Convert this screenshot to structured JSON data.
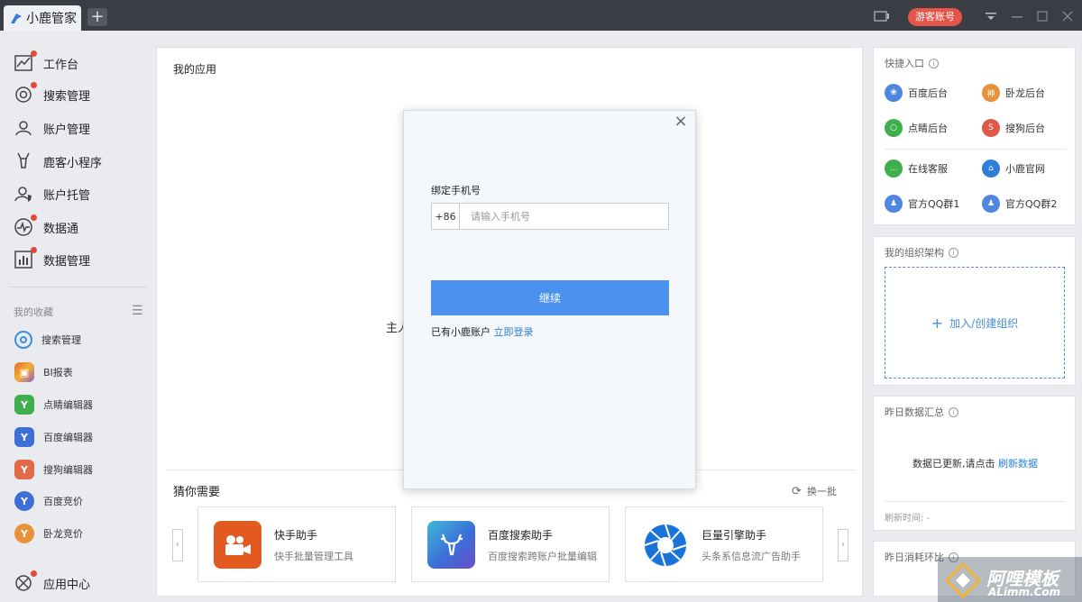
{
  "titlebar": {
    "tab_title": "小鹿管家",
    "add_tab": "+",
    "guest_button": "游客账号"
  },
  "sidebar": {
    "items": [
      {
        "label": "工作台",
        "icon": "chart-icon"
      },
      {
        "label": "搜索管理",
        "icon": "search-icon"
      },
      {
        "label": "账户管理",
        "icon": "user-icon"
      },
      {
        "label": "鹿客小程序",
        "icon": "deer-icon"
      },
      {
        "label": "账户托管",
        "icon": "user-shield-icon"
      },
      {
        "label": "数据通",
        "icon": "pulse-icon"
      },
      {
        "label": "数据管理",
        "icon": "bars-icon"
      }
    ],
    "favorites_title": "我的收藏",
    "favorites": [
      {
        "label": "搜索管理",
        "color": "#3b8ede"
      },
      {
        "label": "BI报表",
        "color": "#e2663b"
      },
      {
        "label": "点睛编辑器",
        "color": "#3fae4c"
      },
      {
        "label": "百度编辑器",
        "color": "#3d6fd6"
      },
      {
        "label": "搜狗编辑器",
        "color": "#e06a49"
      },
      {
        "label": "百度竞价",
        "color": "#3d6fd6"
      },
      {
        "label": "卧龙竞价",
        "color": "#e8903a"
      }
    ],
    "app_center": "应用中心"
  },
  "main": {
    "title": "我的应用",
    "behind_text": "主人",
    "guess_title": "猜你需要",
    "refresh_label": "换一批",
    "cards": [
      {
        "name": "快手助手",
        "desc": "快手批量管理工具",
        "color": "#e25a1f"
      },
      {
        "name": "百度搜索助手",
        "desc": "百度搜索跨账户批量编辑",
        "color": "#3b6fd8"
      },
      {
        "name": "巨量引擎助手",
        "desc": "头条系信息流广告助手",
        "color": "#1a73d9"
      }
    ]
  },
  "quick": {
    "title": "快捷入口",
    "links": [
      {
        "label": "百度后台",
        "color": "#4e86e0"
      },
      {
        "label": "卧龙后台",
        "color": "#e8903a"
      },
      {
        "label": "点睛后台",
        "color": "#3fae4c"
      },
      {
        "label": "搜狗后台",
        "color": "#e0584a"
      },
      {
        "label": "在线客服",
        "color": "#3fae4c"
      },
      {
        "label": "小鹿官网",
        "color": "#2f7fd8"
      },
      {
        "label": "官方QQ群1",
        "color": "#4e86e0"
      },
      {
        "label": "官方QQ群2",
        "color": "#4e86e0"
      }
    ]
  },
  "org": {
    "title": "我的组织架构",
    "action": "加入/创建组织"
  },
  "yesterday": {
    "title": "昨日数据汇总",
    "message": "数据已更新,请点击",
    "link": "刷新数据",
    "refresh_time": "刷新时间: -"
  },
  "consumption": {
    "title": "昨日消耗环比"
  },
  "modal": {
    "label": "绑定手机号",
    "country_code": "+86",
    "phone_placeholder": "请输入手机号",
    "phone_value": "",
    "continue_button": "继续",
    "has_account": "已有小鹿账户",
    "login_link": "立即登录",
    "close": "×"
  },
  "watermark": {
    "text": "阿哩模板",
    "sub": "ALimm.Com"
  }
}
